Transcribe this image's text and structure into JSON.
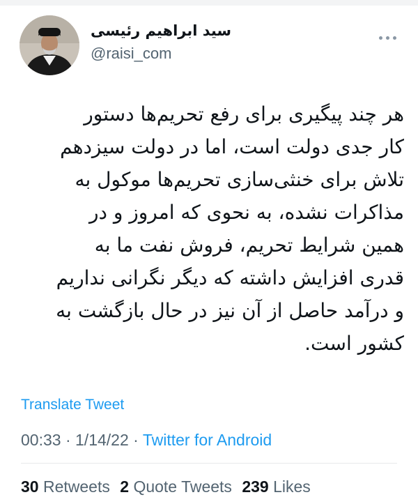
{
  "author": {
    "display_name": "سید ابراهیم رئیسی",
    "handle": "@raisi_com",
    "avatar_icon": "profile-photo"
  },
  "tweet": {
    "lines": [
      "هر چند پیگیری برای رفع تحریم‌ها دستور",
      "کار جدی دولت است، اما در دولت سیزدهم",
      "تلاش برای خنثی‌سازی تحریم‌ها موکول به",
      "مذاکرات نشده، به نحوی که امروز و در",
      "همین شرایط تحریم، فروش نفت ما به",
      "قدری افزایش داشته که دیگر نگرانی نداریم",
      "و درآمد حاصل از آن نیز در حال بازگشت به",
      "کشور است."
    ]
  },
  "actions": {
    "translate_label": "Translate Tweet",
    "more_icon": "more-horizontal-icon"
  },
  "meta": {
    "time": "00:33",
    "separator": "·",
    "date": "1/14/22",
    "source": "Twitter for Android"
  },
  "stats": {
    "retweets_count": "30",
    "retweets_label": "Retweets",
    "quotes_count": "2",
    "quotes_label": "Quote Tweets",
    "likes_count": "239",
    "likes_label": "Likes"
  },
  "colors": {
    "link": "#1d9bf0",
    "muted": "#536471",
    "text": "#0f1419"
  }
}
